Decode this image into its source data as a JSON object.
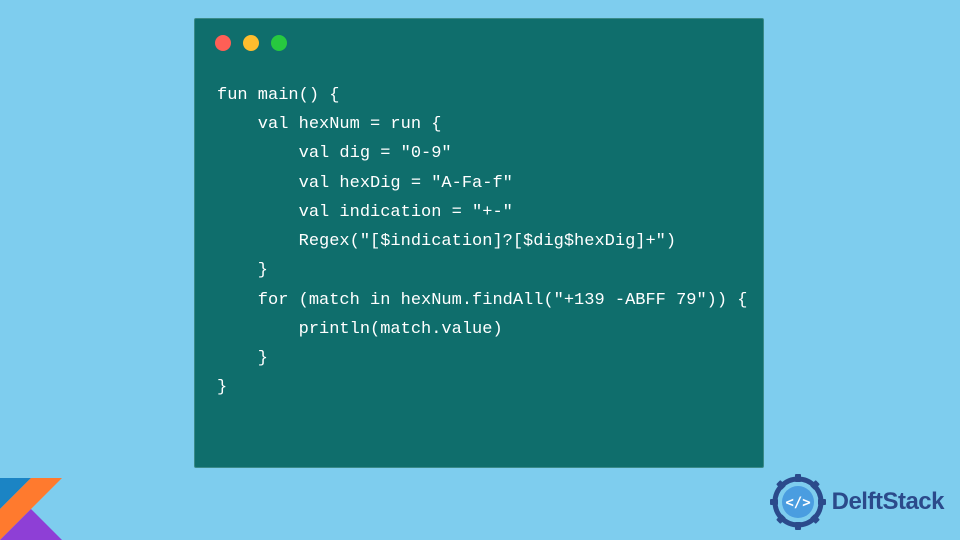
{
  "window": {
    "controls": [
      "red",
      "yellow",
      "green"
    ]
  },
  "code": {
    "lines": [
      "fun main() {",
      "    val hexNum = run {",
      "        val dig = \"0-9\"",
      "        val hexDig = \"A-Fa-f\"",
      "        val indication = \"+-\"",
      "        Regex(\"[$indication]?[$dig$hexDig]+\")",
      "    }",
      "    for (match in hexNum.findAll(\"+139 -ABFF 79\")) {",
      "        println(match.value)",
      "    }",
      "}"
    ]
  },
  "brand": {
    "name": "DelftStack"
  },
  "colors": {
    "background": "#7ecdee",
    "window": "#0f6e6c",
    "brand_text": "#2b4a8b"
  }
}
